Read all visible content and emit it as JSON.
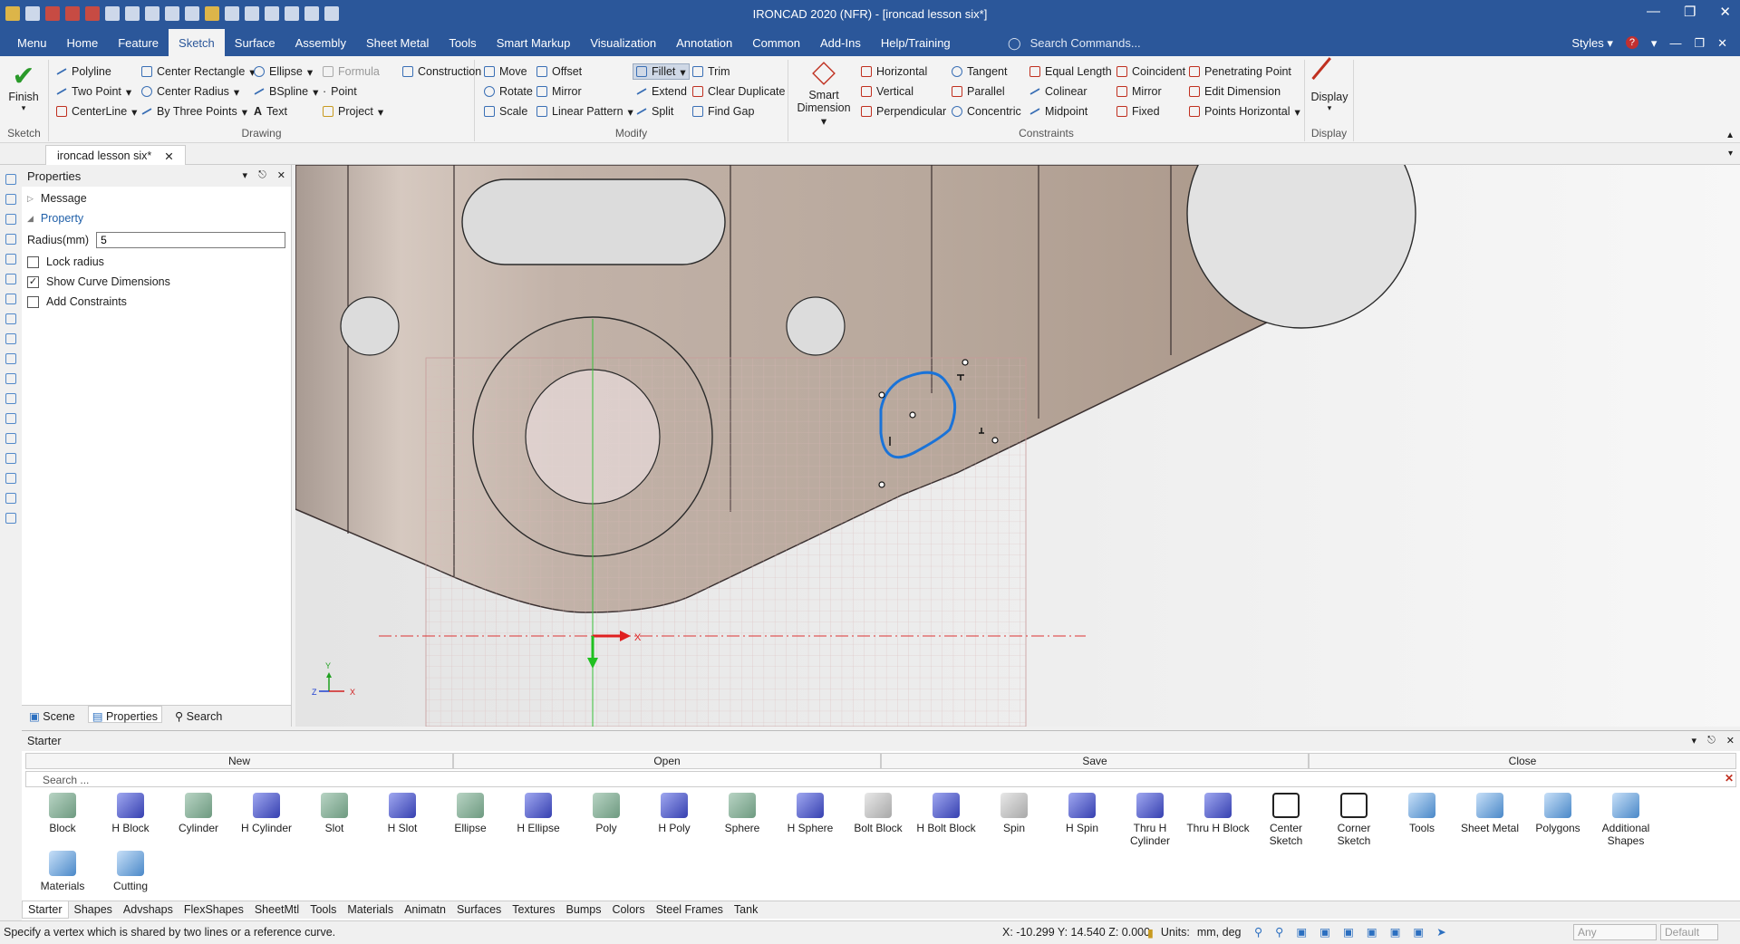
{
  "title": "IRONCAD 2020 (NFR) - [ironcad lesson six*]",
  "menu_tabs": [
    "Menu",
    "Home",
    "Feature",
    "Sketch",
    "Surface",
    "Assembly",
    "Sheet Metal",
    "Tools",
    "Smart Markup",
    "Visualization",
    "Annotation",
    "Common",
    "Add-Ins",
    "Help/Training"
  ],
  "active_tab": "Sketch",
  "search_commands": "Search Commands...",
  "styles_label": "Styles",
  "ribbon": {
    "finish": "Finish",
    "sketch_group": "Sketch",
    "drawing_group": "Drawing",
    "modify_group": "Modify",
    "constraints_group": "Constraints",
    "display_group": "Display",
    "drawing": {
      "polyline": "Polyline",
      "two_point": "Two Point",
      "centerline": "CenterLine",
      "center_rectangle": "Center Rectangle",
      "center_radius": "Center Radius",
      "by_three_points": "By Three Points",
      "ellipse": "Ellipse",
      "bspline": "BSpline",
      "text": "Text",
      "formula": "Formula",
      "point": "Point",
      "project": "Project",
      "construction": "Construction"
    },
    "modify": {
      "move": "Move",
      "rotate": "Rotate",
      "scale": "Scale",
      "offset": "Offset",
      "mirror": "Mirror",
      "linear_pattern": "Linear Pattern",
      "fillet": "Fillet",
      "extend": "Extend",
      "split": "Split",
      "trim": "Trim",
      "clear_duplicate": "Clear Duplicate",
      "find_gap": "Find Gap"
    },
    "smart_dimension_1": "Smart",
    "smart_dimension_2": "Dimension",
    "constraints": {
      "horizontal": "Horizontal",
      "vertical": "Vertical",
      "perpendicular": "Perpendicular",
      "tangent": "Tangent",
      "parallel": "Parallel",
      "concentric": "Concentric",
      "equal_length": "Equal Length",
      "colinear": "Colinear",
      "midpoint": "Midpoint",
      "coincident": "Coincident",
      "mirror": "Mirror",
      "fixed": "Fixed",
      "penetrating_point": "Penetrating Point",
      "edit_dimension": "Edit Dimension",
      "points_horizontal": "Points Horizontal"
    },
    "display": "Display"
  },
  "doc_tab": "ironcad lesson six*",
  "properties": {
    "title": "Properties",
    "message": "Message",
    "property": "Property",
    "radius_label": "Radius(mm)",
    "radius_value": "5",
    "lock_radius": "Lock radius",
    "lock_radius_checked": false,
    "show_curve_dimensions": "Show Curve Dimensions",
    "show_curve_dimensions_checked": true,
    "add_constraints": "Add Constraints",
    "add_constraints_checked": false,
    "tabs": [
      "Scene",
      "Properties",
      "Search"
    ],
    "active_tab": "Properties"
  },
  "viewport": {
    "axis_x": "X",
    "axis_y": "Y",
    "axis_z": "Z"
  },
  "starter": {
    "title": "Starter",
    "buttons": [
      "New",
      "Open",
      "Save",
      "Close"
    ],
    "search_placeholder": "Search ...",
    "shapes": [
      "Block",
      "H Block",
      "Cylinder",
      "H Cylinder",
      "Slot",
      "H Slot",
      "Ellipse",
      "H Ellipse",
      "Poly",
      "H Poly",
      "Sphere",
      "H Sphere",
      "Bolt Block",
      "H Bolt Block",
      "Spin",
      "H Spin",
      "Thru H Cylinder",
      "Thru H Block",
      "Center Sketch",
      "Corner Sketch",
      "Tools",
      "Sheet Metal",
      "Polygons",
      "Additional Shapes"
    ],
    "shapes_row2": [
      "Materials",
      "Cutting"
    ]
  },
  "catalog_tabs": [
    "Starter",
    "Shapes",
    "Advshaps",
    "FlexShapes",
    "SheetMtl",
    "Tools",
    "Materials",
    "Animatn",
    "Surfaces",
    "Textures",
    "Bumps",
    "Colors",
    "Steel Frames",
    "Tank"
  ],
  "status": {
    "message": "Specify a vertex which is shared by two lines or a reference curve.",
    "coords": "X: -10.299 Y: 14.540 Z: 0.000",
    "units_label": "Units:",
    "units_value": "mm, deg",
    "filter": "Any",
    "style": "Default"
  }
}
